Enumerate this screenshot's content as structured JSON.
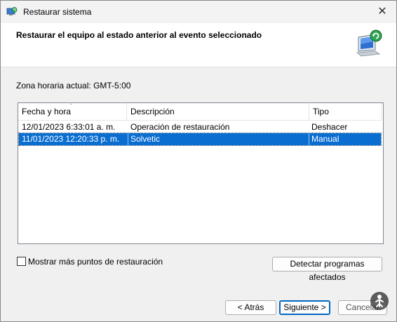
{
  "window": {
    "title": "Restaurar sistema",
    "close_glyph": "✕"
  },
  "header": {
    "title": "Restaurar el equipo al estado anterior al evento seleccionado",
    "icon": "system-restore-monitor-icon"
  },
  "timezone_label": "Zona horaria actual: GMT-5:00",
  "table": {
    "columns": [
      "Fecha y hora",
      "Descripción",
      "Tipo"
    ],
    "sort_indicator": "ˇ",
    "rows": [
      {
        "date": "12/01/2023 6:33:01 a. m.",
        "description": "Operación de restauración",
        "type": "Deshacer",
        "selected": false
      },
      {
        "date": "11/01/2023 12:20:33 p. m.",
        "description": "Solvetic",
        "type": "Manual",
        "selected": true
      }
    ]
  },
  "checkbox": {
    "label": "Mostrar más puntos de restauración",
    "checked": false
  },
  "buttons": {
    "detect": "Detectar programas afectados",
    "back": "< Atrás",
    "next": "Siguiente >",
    "cancel": "Cancelar"
  },
  "colors": {
    "selection": "#0a6ed1",
    "accent": "#0067c0"
  }
}
